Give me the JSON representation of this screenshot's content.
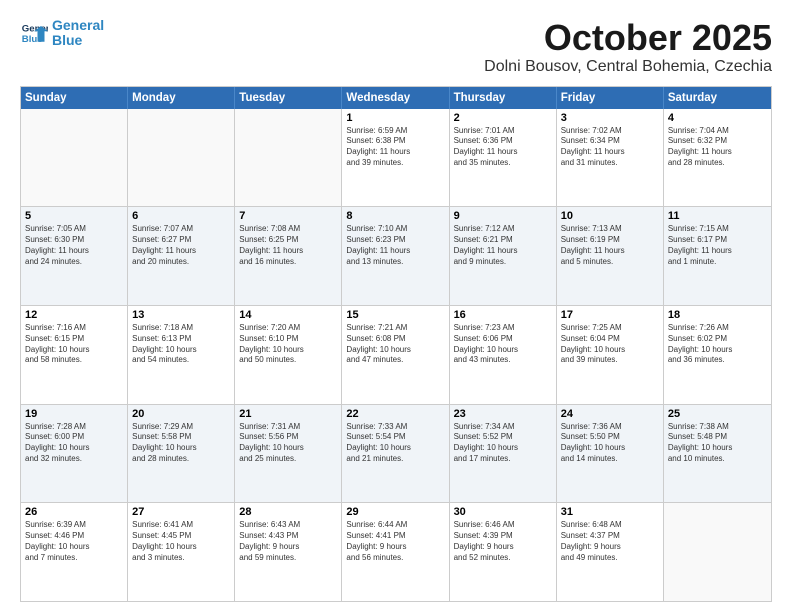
{
  "logo": {
    "line1": "General",
    "line2": "Blue"
  },
  "title": "October 2025",
  "location": "Dolni Bousov, Central Bohemia, Czechia",
  "weekdays": [
    "Sunday",
    "Monday",
    "Tuesday",
    "Wednesday",
    "Thursday",
    "Friday",
    "Saturday"
  ],
  "rows": [
    [
      {
        "day": "",
        "text": "",
        "empty": true
      },
      {
        "day": "",
        "text": "",
        "empty": true
      },
      {
        "day": "",
        "text": "",
        "empty": true
      },
      {
        "day": "1",
        "text": "Sunrise: 6:59 AM\nSunset: 6:38 PM\nDaylight: 11 hours\nand 39 minutes."
      },
      {
        "day": "2",
        "text": "Sunrise: 7:01 AM\nSunset: 6:36 PM\nDaylight: 11 hours\nand 35 minutes."
      },
      {
        "day": "3",
        "text": "Sunrise: 7:02 AM\nSunset: 6:34 PM\nDaylight: 11 hours\nand 31 minutes."
      },
      {
        "day": "4",
        "text": "Sunrise: 7:04 AM\nSunset: 6:32 PM\nDaylight: 11 hours\nand 28 minutes."
      }
    ],
    [
      {
        "day": "5",
        "text": "Sunrise: 7:05 AM\nSunset: 6:30 PM\nDaylight: 11 hours\nand 24 minutes."
      },
      {
        "day": "6",
        "text": "Sunrise: 7:07 AM\nSunset: 6:27 PM\nDaylight: 11 hours\nand 20 minutes."
      },
      {
        "day": "7",
        "text": "Sunrise: 7:08 AM\nSunset: 6:25 PM\nDaylight: 11 hours\nand 16 minutes."
      },
      {
        "day": "8",
        "text": "Sunrise: 7:10 AM\nSunset: 6:23 PM\nDaylight: 11 hours\nand 13 minutes."
      },
      {
        "day": "9",
        "text": "Sunrise: 7:12 AM\nSunset: 6:21 PM\nDaylight: 11 hours\nand 9 minutes."
      },
      {
        "day": "10",
        "text": "Sunrise: 7:13 AM\nSunset: 6:19 PM\nDaylight: 11 hours\nand 5 minutes."
      },
      {
        "day": "11",
        "text": "Sunrise: 7:15 AM\nSunset: 6:17 PM\nDaylight: 11 hours\nand 1 minute."
      }
    ],
    [
      {
        "day": "12",
        "text": "Sunrise: 7:16 AM\nSunset: 6:15 PM\nDaylight: 10 hours\nand 58 minutes."
      },
      {
        "day": "13",
        "text": "Sunrise: 7:18 AM\nSunset: 6:13 PM\nDaylight: 10 hours\nand 54 minutes."
      },
      {
        "day": "14",
        "text": "Sunrise: 7:20 AM\nSunset: 6:10 PM\nDaylight: 10 hours\nand 50 minutes."
      },
      {
        "day": "15",
        "text": "Sunrise: 7:21 AM\nSunset: 6:08 PM\nDaylight: 10 hours\nand 47 minutes."
      },
      {
        "day": "16",
        "text": "Sunrise: 7:23 AM\nSunset: 6:06 PM\nDaylight: 10 hours\nand 43 minutes."
      },
      {
        "day": "17",
        "text": "Sunrise: 7:25 AM\nSunset: 6:04 PM\nDaylight: 10 hours\nand 39 minutes."
      },
      {
        "day": "18",
        "text": "Sunrise: 7:26 AM\nSunset: 6:02 PM\nDaylight: 10 hours\nand 36 minutes."
      }
    ],
    [
      {
        "day": "19",
        "text": "Sunrise: 7:28 AM\nSunset: 6:00 PM\nDaylight: 10 hours\nand 32 minutes."
      },
      {
        "day": "20",
        "text": "Sunrise: 7:29 AM\nSunset: 5:58 PM\nDaylight: 10 hours\nand 28 minutes."
      },
      {
        "day": "21",
        "text": "Sunrise: 7:31 AM\nSunset: 5:56 PM\nDaylight: 10 hours\nand 25 minutes."
      },
      {
        "day": "22",
        "text": "Sunrise: 7:33 AM\nSunset: 5:54 PM\nDaylight: 10 hours\nand 21 minutes."
      },
      {
        "day": "23",
        "text": "Sunrise: 7:34 AM\nSunset: 5:52 PM\nDaylight: 10 hours\nand 17 minutes."
      },
      {
        "day": "24",
        "text": "Sunrise: 7:36 AM\nSunset: 5:50 PM\nDaylight: 10 hours\nand 14 minutes."
      },
      {
        "day": "25",
        "text": "Sunrise: 7:38 AM\nSunset: 5:48 PM\nDaylight: 10 hours\nand 10 minutes."
      }
    ],
    [
      {
        "day": "26",
        "text": "Sunrise: 6:39 AM\nSunset: 4:46 PM\nDaylight: 10 hours\nand 7 minutes."
      },
      {
        "day": "27",
        "text": "Sunrise: 6:41 AM\nSunset: 4:45 PM\nDaylight: 10 hours\nand 3 minutes."
      },
      {
        "day": "28",
        "text": "Sunrise: 6:43 AM\nSunset: 4:43 PM\nDaylight: 9 hours\nand 59 minutes."
      },
      {
        "day": "29",
        "text": "Sunrise: 6:44 AM\nSunset: 4:41 PM\nDaylight: 9 hours\nand 56 minutes."
      },
      {
        "day": "30",
        "text": "Sunrise: 6:46 AM\nSunset: 4:39 PM\nDaylight: 9 hours\nand 52 minutes."
      },
      {
        "day": "31",
        "text": "Sunrise: 6:48 AM\nSunset: 4:37 PM\nDaylight: 9 hours\nand 49 minutes."
      },
      {
        "day": "",
        "text": "",
        "empty": true
      }
    ]
  ]
}
